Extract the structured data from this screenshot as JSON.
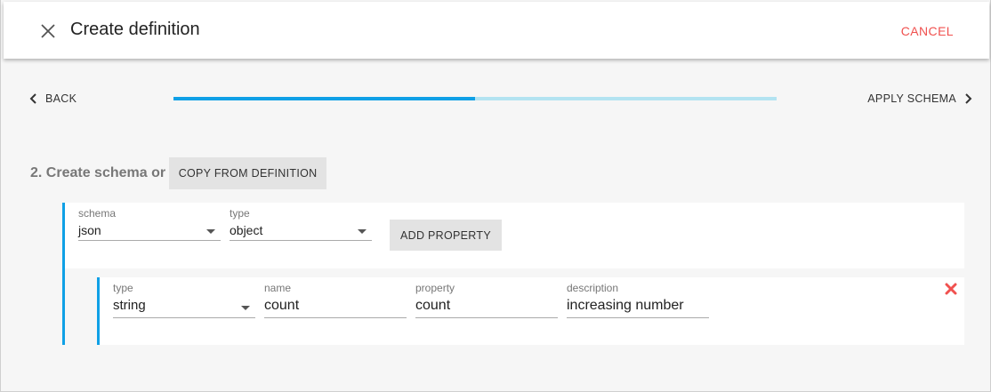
{
  "header": {
    "title": "Create definition",
    "cancel_label": "CANCEL"
  },
  "stepper": {
    "back_label": "BACK",
    "next_label": "APPLY SCHEMA",
    "progress": 0.5
  },
  "step": {
    "label": "2. Create schema or",
    "copy_button": "COPY FROM DEFINITION"
  },
  "schema": {
    "schema_field": {
      "label": "schema",
      "value": "json"
    },
    "type_field": {
      "label": "type",
      "value": "object"
    },
    "add_property_button": "ADD PROPERTY"
  },
  "property": {
    "type_field": {
      "label": "type",
      "value": "string"
    },
    "name_field": {
      "label": "name",
      "value": "count"
    },
    "property_field": {
      "label": "property",
      "value": "count"
    },
    "description_field": {
      "label": "description",
      "value": "increasing number"
    }
  },
  "colors": {
    "accent": "#0fa0e6",
    "progress_track": "#b3e3f1",
    "danger": "#f0514f"
  }
}
